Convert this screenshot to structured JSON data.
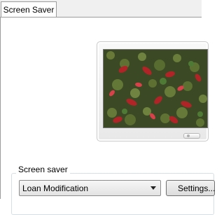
{
  "tabs": [
    {
      "label": "Screen Saver"
    }
  ],
  "screen_saver_group": {
    "label": "Screen saver",
    "selected": "Loan Modification",
    "settings_label": "Settings..."
  },
  "preview": {
    "image": "leaves-foliage-preview"
  },
  "colors": {
    "panel_border": "#9c9c9c",
    "group_border": "#d5dfe5",
    "leaf_red": "#c0282a",
    "leaf_green": "#6f8f3a"
  }
}
